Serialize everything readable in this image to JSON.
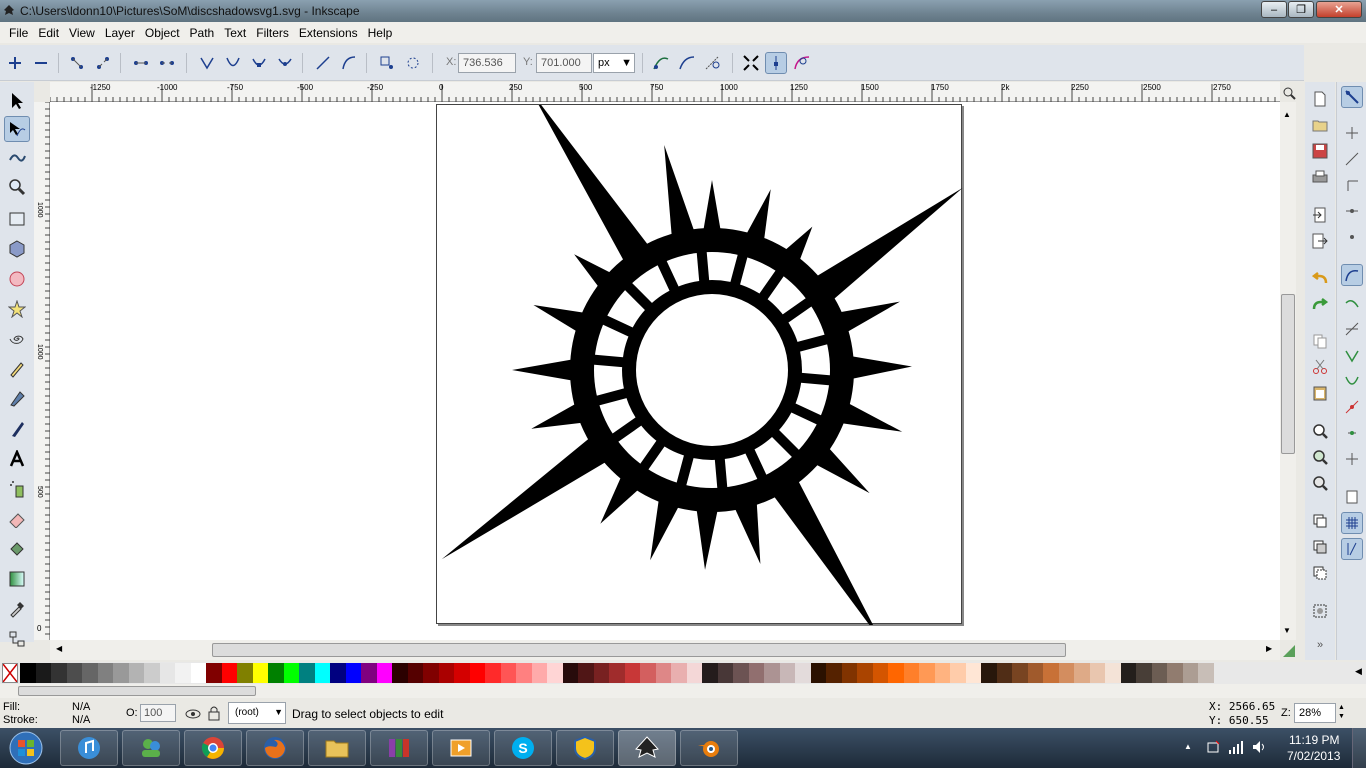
{
  "window": {
    "title": "C:\\Users\\ldonn10\\Pictures\\SoM\\discshadowsvg1.svg - Inkscape"
  },
  "menu": [
    "File",
    "Edit",
    "View",
    "Layer",
    "Object",
    "Path",
    "Text",
    "Filters",
    "Extensions",
    "Help"
  ],
  "toolbar": {
    "x_label": "X:",
    "x_value": "736.536",
    "y_label": "Y:",
    "y_value": "701.000",
    "unit": "px"
  },
  "ruler": {
    "h_ticks": [
      "-1250",
      "-1000",
      "-750",
      "-500",
      "-250",
      "0",
      "250",
      "500",
      "750",
      "1000",
      "1250",
      "1500",
      "1750",
      "2k",
      "2250",
      "2500",
      "2750"
    ],
    "v_ticks": [
      "1000",
      "1000",
      "500",
      "0"
    ]
  },
  "palette": [
    "#000000",
    "#1a1a1a",
    "#333333",
    "#4d4d4d",
    "#666666",
    "#808080",
    "#999999",
    "#b3b3b3",
    "#cccccc",
    "#e6e6e6",
    "#f2f2f2",
    "#ffffff",
    "#800000",
    "#ff0000",
    "#808000",
    "#ffff00",
    "#008000",
    "#00ff00",
    "#008080",
    "#00ffff",
    "#000080",
    "#0000ff",
    "#800080",
    "#ff00ff",
    "#2b0000",
    "#550000",
    "#800000",
    "#aa0000",
    "#d40000",
    "#ff0000",
    "#ff2a2a",
    "#ff5555",
    "#ff8080",
    "#ffaaaa",
    "#ffd5d5",
    "#280b0b",
    "#501616",
    "#782121",
    "#a02c2c",
    "#c83737",
    "#d35f5f",
    "#de8787",
    "#e9afaf",
    "#f4d7d7",
    "#241c1c",
    "#483737",
    "#6c5353",
    "#916f6f",
    "#ac9393",
    "#c8b7b7",
    "#e3dbdb",
    "#2b1100",
    "#552200",
    "#803300",
    "#aa4400",
    "#d45500",
    "#ff6600",
    "#ff7f2a",
    "#ff9955",
    "#ffb380",
    "#ffccaa",
    "#ffe6d5",
    "#28170b",
    "#502d16",
    "#784421",
    "#a05a2c",
    "#c87137",
    "#d38d5f",
    "#deaa87",
    "#e9c6af",
    "#f4e3d7",
    "#241f1c",
    "#483e37",
    "#6c5d53",
    "#917c6f",
    "#ac9d93",
    "#c8beb7"
  ],
  "status": {
    "fill_label": "Fill:",
    "fill_value": "N/A",
    "stroke_label": "Stroke:",
    "stroke_value": "N/A",
    "opacity_label": "O:",
    "opacity_value": "100",
    "layer": "(root)",
    "message": "Drag to select objects to edit",
    "cursor_x": "X: 2566.65",
    "cursor_y": "Y:  650.55",
    "zoom_label": "Z:",
    "zoom_value": "28%"
  },
  "taskbar": {
    "time": "11:19 PM",
    "date": "7/02/2013"
  }
}
